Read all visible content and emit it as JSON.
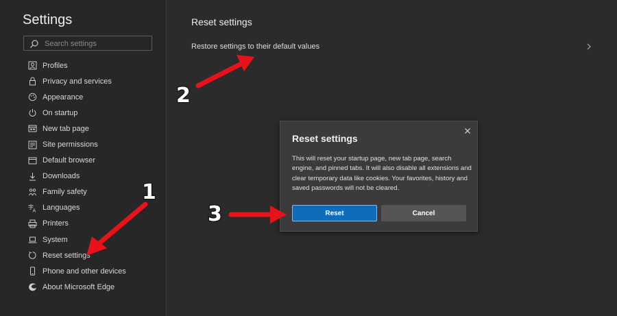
{
  "sidebar": {
    "title": "Settings",
    "search_placeholder": "Search settings",
    "items": [
      {
        "label": "Profiles",
        "icon": "profile-icon"
      },
      {
        "label": "Privacy and services",
        "icon": "lock-icon"
      },
      {
        "label": "Appearance",
        "icon": "palette-icon"
      },
      {
        "label": "On startup",
        "icon": "power-icon"
      },
      {
        "label": "New tab page",
        "icon": "new-tab-icon"
      },
      {
        "label": "Site permissions",
        "icon": "site-permissions-icon"
      },
      {
        "label": "Default browser",
        "icon": "browser-icon"
      },
      {
        "label": "Downloads",
        "icon": "download-icon"
      },
      {
        "label": "Family safety",
        "icon": "family-icon"
      },
      {
        "label": "Languages",
        "icon": "languages-icon"
      },
      {
        "label": "Printers",
        "icon": "printer-icon"
      },
      {
        "label": "System",
        "icon": "laptop-icon"
      },
      {
        "label": "Reset settings",
        "icon": "reset-icon"
      },
      {
        "label": "Phone and other devices",
        "icon": "phone-icon"
      },
      {
        "label": "About Microsoft Edge",
        "icon": "edge-icon"
      }
    ]
  },
  "main": {
    "title": "Reset settings",
    "restore_label": "Restore settings to their default values"
  },
  "dialog": {
    "title": "Reset settings",
    "body": "This will reset your startup page, new tab page, search engine, and pinned tabs. It will also disable all extensions and clear temporary data like cookies. Your favorites, history and saved passwords will not be cleared.",
    "reset_label": "Reset",
    "cancel_label": "Cancel"
  },
  "annotations": {
    "step1": "1",
    "step2": "2",
    "step3": "3",
    "arrow_color": "#e8121b"
  },
  "colors": {
    "accent": "#0f6cbd"
  }
}
